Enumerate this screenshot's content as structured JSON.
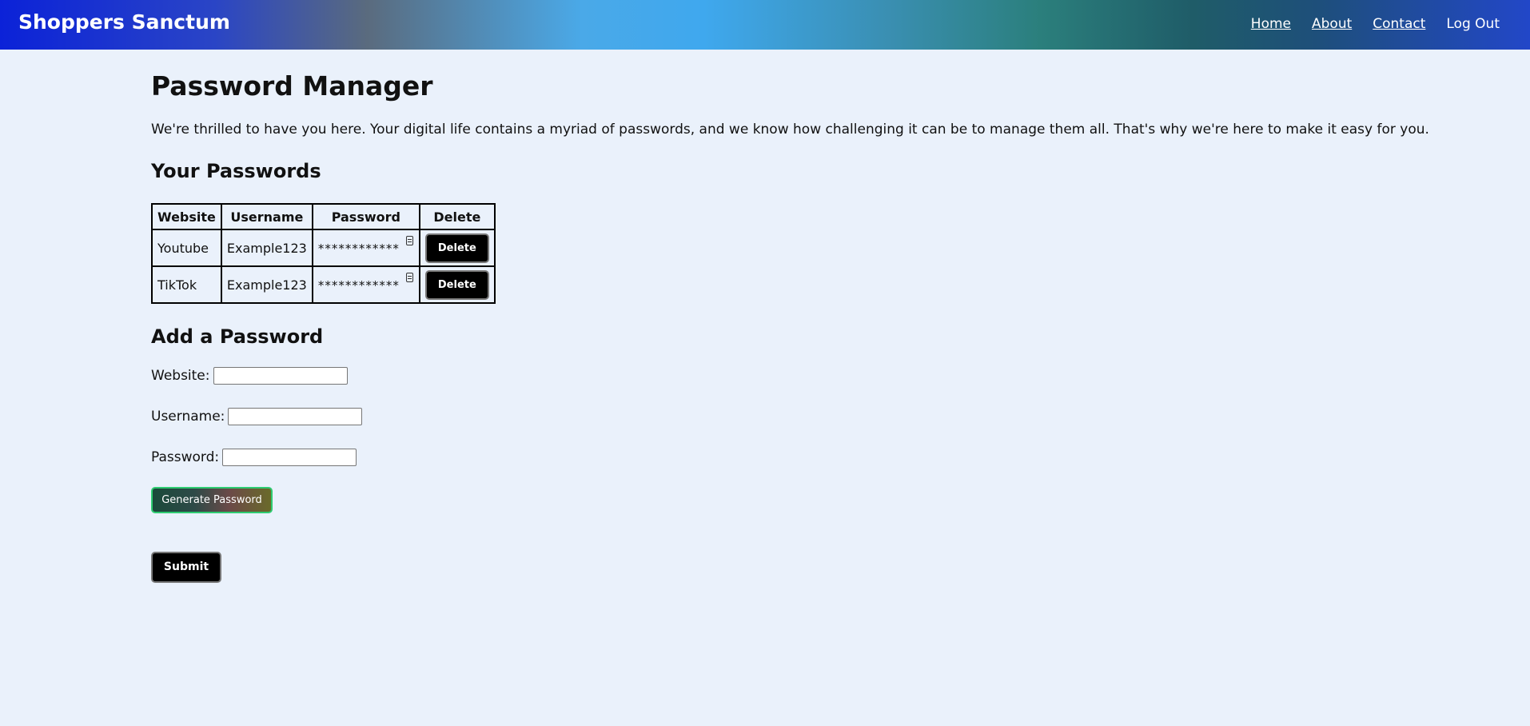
{
  "header": {
    "brand": "Shoppers Sanctum",
    "nav": [
      "Home",
      "About",
      "Contact",
      "Log Out"
    ]
  },
  "main": {
    "title": "Password Manager",
    "intro": "We're thrilled to have you here. Your digital life contains a myriad of passwords, and we know how challenging it can be to manage them all. That's why we're here to make it easy for you.",
    "passwords_heading": "Your Passwords",
    "table": {
      "headers": [
        "Website",
        "Username",
        "Password",
        "Delete"
      ],
      "rows": [
        {
          "website": "Youtube",
          "username": "Example123",
          "password": "************",
          "delete_label": "Delete"
        },
        {
          "website": "TikTok",
          "username": "Example123",
          "password": "************",
          "delete_label": "Delete"
        }
      ]
    },
    "add_heading": "Add a Password",
    "form": {
      "website_label": "Website:",
      "username_label": "Username:",
      "password_label": "Password:",
      "website_value": "",
      "username_value": "",
      "password_value": "",
      "generate_label": "Generate Password",
      "submit_label": "Submit"
    }
  },
  "colors": {
    "page_background": "#eaf1fb",
    "button_black": "#000000",
    "generate_border": "#2ecc71"
  },
  "icons": [
    "copy-icon"
  ]
}
